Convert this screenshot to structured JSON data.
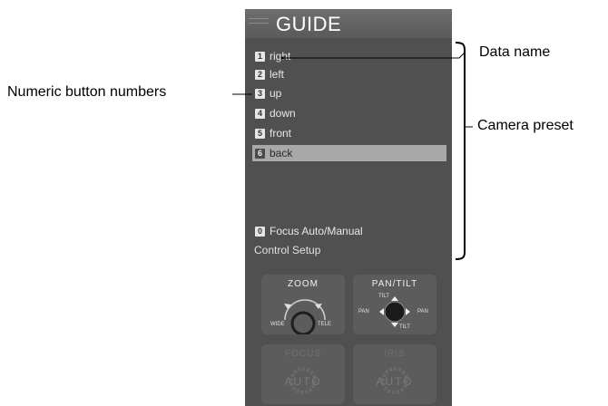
{
  "guide": {
    "title": "GUIDE",
    "presets": [
      {
        "num": "1",
        "label": "right"
      },
      {
        "num": "2",
        "label": "left"
      },
      {
        "num": "3",
        "label": "up"
      },
      {
        "num": "4",
        "label": "down"
      },
      {
        "num": "5",
        "label": "front"
      },
      {
        "num": "6",
        "label": "back",
        "selected": true
      }
    ],
    "focus_item": {
      "num": "0",
      "label": "Focus Auto/Manual"
    },
    "control_setup": "Control Setup"
  },
  "controls": {
    "zoom": {
      "title": "ZOOM",
      "wide": "WIDE",
      "tele": "TELE"
    },
    "pantilt": {
      "title": "PAN/TILT",
      "tilt_up": "TILT",
      "tilt_down": "TILT",
      "pan_left": "PAN",
      "pan_right": "PAN"
    },
    "focus": {
      "title": "FOCUS",
      "mode": "AUTO"
    },
    "iris": {
      "title": "IRIS",
      "mode": "AUTO"
    }
  },
  "annotations": {
    "data_name": "Data name",
    "numeric_buttons": "Numeric button numbers",
    "camera_preset": "Camera preset"
  },
  "colors": {
    "panel": "#505050",
    "selected_row": "#a8a8a8",
    "text": "#e8e8e8"
  }
}
